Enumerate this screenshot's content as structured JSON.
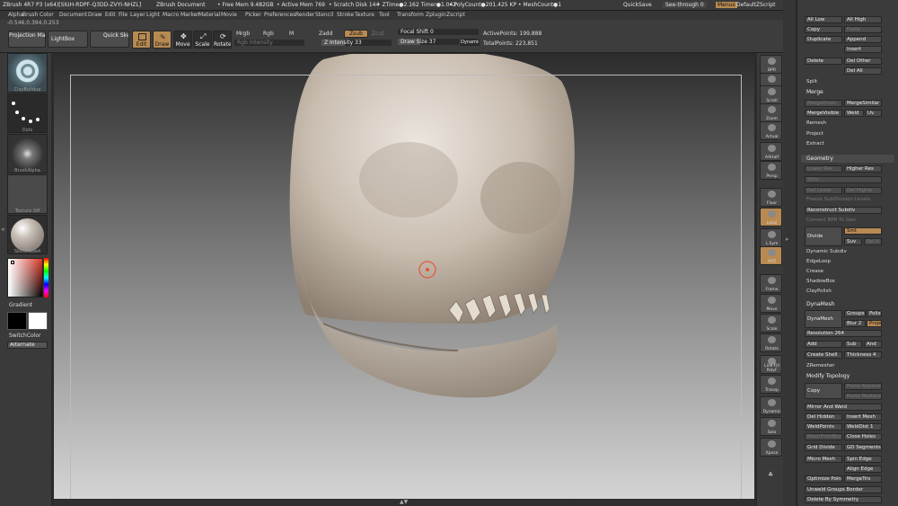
{
  "titlebar": {
    "app": "ZBrush 4R7 P3 (x64)[SIUH-RDPF-Q3DD-ZVYI-NHZL]",
    "doc": "ZBrush Document",
    "free_mem": "• Free Mem 9.482GB",
    "active_mem": "• Active Mem 769",
    "scratch": "• Scratch Disk 144",
    "ztime": "• ZTime●2.162 Timer●1.042",
    "polycount": "• PolyCount●201.425 KP",
    "meshcount": "• MeshCount●1",
    "quicksave": "QuickSave",
    "see_through": "See-through  0",
    "menus": "Menus",
    "default_zscript": "DefaultZScript"
  },
  "menubar": [
    "Alpha",
    "Brush",
    "Color",
    "Document",
    "Draw",
    "Edit",
    "File",
    "Layer",
    "Light",
    "Macro",
    "Marker",
    "Material",
    "Movie",
    "Picker",
    "Preferences",
    "Render",
    "Stencil",
    "Stroke",
    "Texture",
    "Tool",
    "Transform",
    "Zplugin",
    "Zscript"
  ],
  "coords": "-0.546,0.394,0.253",
  "toolbar": {
    "projection_master": "Projection Master",
    "lightbox": "LightBox",
    "quick_sketch": "Quick Sketch",
    "edit": "Edit",
    "draw": "Draw",
    "move": "Move",
    "scale": "Scale",
    "rotate": "Rotate",
    "mrgb": "Mrgb",
    "rgb": "Rgb",
    "m": "M",
    "rgb_intensity": "Rgb Intensity",
    "zadd": "Zadd",
    "zsub": "Zsub",
    "zcut": "Zcut",
    "z_intensity": "Z Intensity 33",
    "focal_shift": "Focal Shift 0",
    "draw_size": "Draw Size 37",
    "dynamic": "Dynamic",
    "active_points": "ActivePoints: 199,888",
    "total_points": "TotalPoints: 223,851"
  },
  "toolbar_values": {
    "z_intensity": 33,
    "z_intensity_max": 100,
    "focal_shift": 0,
    "draw_size": 37,
    "draw_size_max": 100
  },
  "leftshelf": {
    "brush_cap": "ClayBuildup",
    "stroke_cap": "Dots",
    "alpha_cap": "BrushAlpha",
    "texture_cap": "Texture Off",
    "material_cap": "SkinShade4",
    "gradient": "Gradient",
    "switch_color": "SwitchColor",
    "alternate": "Alternate"
  },
  "rightshelf": [
    "BPR",
    "SPix 3",
    "Scroll",
    "Zoom",
    "Actual",
    "AAHalf",
    "Persp",
    "Floor",
    "Local",
    "L.Sym",
    "XYZ",
    "Frame",
    "Move",
    "Scale",
    "Rotate",
    "Line Fill PolyF",
    "Transp",
    "Dynamic",
    "Solo",
    "Xpose"
  ],
  "panel": {
    "top_rows": [
      [
        "All Low",
        "All High"
      ],
      [
        "Copy",
        "Paste"
      ],
      [
        "Duplicate",
        "Append"
      ],
      [
        "",
        "Insert"
      ],
      [
        "Delete",
        "Del Other"
      ],
      [
        "",
        "Del All"
      ]
    ],
    "split": "Split",
    "merge_head": "Merge",
    "merge_rows": [
      [
        "MergeDown",
        "MergeSimilar"
      ],
      [
        "MergeVisible",
        "Weld",
        "Uv"
      ]
    ],
    "remesh": "Remesh",
    "project": "Project",
    "extract": "Extract",
    "geometry": "Geometry",
    "geo_rows": [
      [
        "Lower Res",
        "Higher Res"
      ],
      [
        "SDiv",
        ""
      ],
      [
        "Del Lower",
        "Del Higher"
      ]
    ],
    "freeze": "Freeze SubDivision Levels",
    "reconstruct": "Reconstruct Subdiv",
    "convert": "Convert BPR To Geo",
    "divide": "Divide",
    "smt": "Smt",
    "suv": "Suv",
    "rsuv": "ReUV",
    "dyn_list": [
      "Dynamic Subdiv",
      "EdgeLoop",
      "Crease",
      "ShadowBox",
      "ClayPolish"
    ],
    "dynamesh_head": "DynaMesh",
    "dynamesh": "DynaMesh",
    "groups": "Groups",
    "polish": "Polish",
    "blur": "Blur 2",
    "project2": "Project",
    "resolution": "Resolution 264",
    "add": "Add",
    "sub": "Sub",
    "and": "And",
    "create_shell": "Create Shell",
    "thickness": "Thickness 4",
    "zremesher": "ZRemesher",
    "modify_topology": "Modify Topology",
    "copy2": "Copy",
    "paste_append": "Paste Append",
    "paste_replace": "Paste Replace",
    "mod_rows": [
      [
        "Mirror And Weld",
        ""
      ],
      [
        "Del Hidden",
        "Insert Mesh"
      ],
      [
        "WeldPoints",
        "WeldDist 1"
      ],
      [
        "MeshFromBrush",
        "Close Holes"
      ],
      [
        "Grid Divide",
        "GD Segments"
      ],
      [
        "Micro Mesh",
        "Spin Edge"
      ],
      [
        "",
        "Align Edge"
      ],
      [
        "Optimize Points",
        "MergeTris"
      ],
      [
        "Unweld Groups Border",
        ""
      ],
      [
        "Delete By Symmetry",
        ""
      ]
    ]
  },
  "colors": {
    "accent": "#b88a52",
    "bg": "#2b2b2b",
    "panel": "#3b3b3b"
  },
  "resolution_value": 264,
  "bottom_marker": "▲▼"
}
